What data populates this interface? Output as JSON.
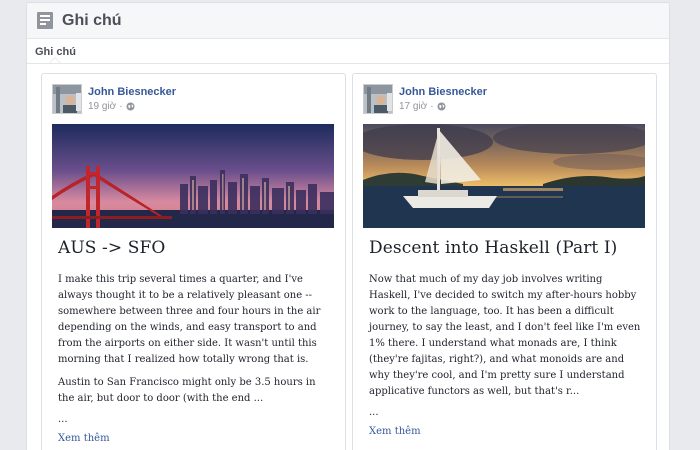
{
  "header": {
    "title": "Ghi chú",
    "icon": "notes-icon"
  },
  "subnav": {
    "tab_label": "Ghi chú"
  },
  "notes": [
    {
      "author": "John Biesnecker",
      "time": "19 giờ",
      "dot": "·",
      "privacy_icon": "globe-icon",
      "cover": "golden-gate-city-skyline-image",
      "title": "AUS -> SFO",
      "paragraphs": [
        "I make this trip several times a quarter, and I've always thought it to be a relatively pleasant one -- somewhere between three and four hours in the air depending on the winds, and easy transport to and from the airports on either side. It wasn't until this morning that I realized how totally wrong that is.",
        "Austin to San Francisco might only be 3.5 hours in the air, but door to door (with the end ..."
      ],
      "ellipsis": "...",
      "see_more": "Xem thêm"
    },
    {
      "author": "John Biesnecker",
      "time": "17 giờ",
      "dot": "·",
      "privacy_icon": "globe-icon",
      "cover": "sailboat-sunset-image",
      "title": "Descent into Haskell (Part I)",
      "paragraphs": [
        "Now that much of my day job involves writing Haskell, I've decided to switch my after-hours hobby work to the language, too. It has been a difficult journey, to say the least, and I don't feel like I'm even 1% there. I understand what monads are, I think (they're fajitas, right?), and what monoids are and why they're cool, and I'm pretty sure I understand applicative functors as well, but that's r..."
      ],
      "ellipsis": "...",
      "see_more": "Xem thêm"
    }
  ],
  "colors": {
    "link": "#365899",
    "meta": "#90949c",
    "page_bg": "#e9eaed"
  }
}
